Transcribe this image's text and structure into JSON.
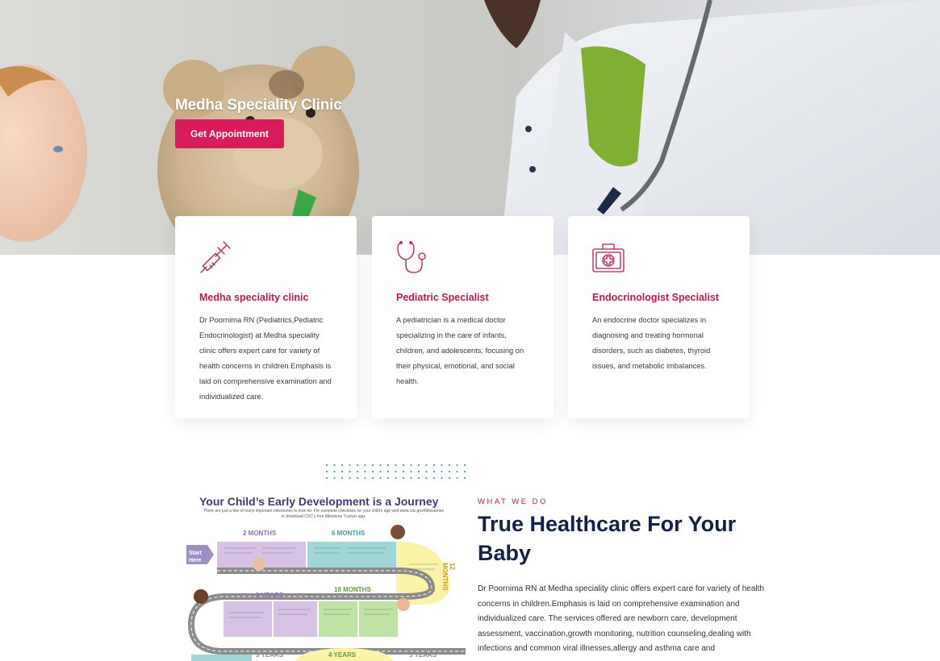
{
  "hero": {
    "title": "Medha Speciality Clinic",
    "button_label": "Get Appointment"
  },
  "cards": [
    {
      "icon": "syringe-icon",
      "title": "Medha speciality clinic",
      "text": "Dr Poornima RN (Pediatrics,Pediatric Endocrinologist) at Medha speciality clinic offers expert care for variety of health concerns in children.Emphasis is laid on comprehensive examination and individualized care."
    },
    {
      "icon": "stethoscope-icon",
      "title": "Pediatric Specialist",
      "text": "A pediatrician is a medical doctor specializing in the care of infants, children, and adolescents, focusing on their physical, emotional, and social health."
    },
    {
      "icon": "first-aid-kit-icon",
      "title": "Endocrinologist Specialist",
      "text": "An endocrine doctor specializes in diagnosing and treating hormonal disorders, such as diabetes, thyroid issues, and metabolic imbalances."
    }
  ],
  "infographic": {
    "title": "Your Child’s Early Development is a Journey",
    "subtitle": "There are just a few of many important milestones to look for. For complete checklists for your child's age visit www.cdc.gov/Milestones or download CDC's free Milestone Tracker app.",
    "start_label": "Start Here",
    "milestones": [
      "2 MONTHS",
      "6 MONTHS",
      "12 MONTHS",
      "18 MONTHS",
      "2 YEARS",
      "3 YEARS",
      "4 YEARS",
      "5 YEARS"
    ]
  },
  "about": {
    "eyebrow": "WHAT WE DO",
    "heading": "True Healthcare For Your Baby",
    "text": "Dr Poornima RN at Medha speciality clinic offers expert care for variety of health concerns in children.Emphasis is laid on comprehensive examination and individualized care. The services offered are newborn care, development assessment, vaccination,growth monitoring, nutrition counseling,dealing with infections and common viral illnesses,allergy and asthma care and"
  },
  "colors": {
    "accent": "#d81b5a",
    "card_title": "#c8194f",
    "heading": "#12224a"
  }
}
